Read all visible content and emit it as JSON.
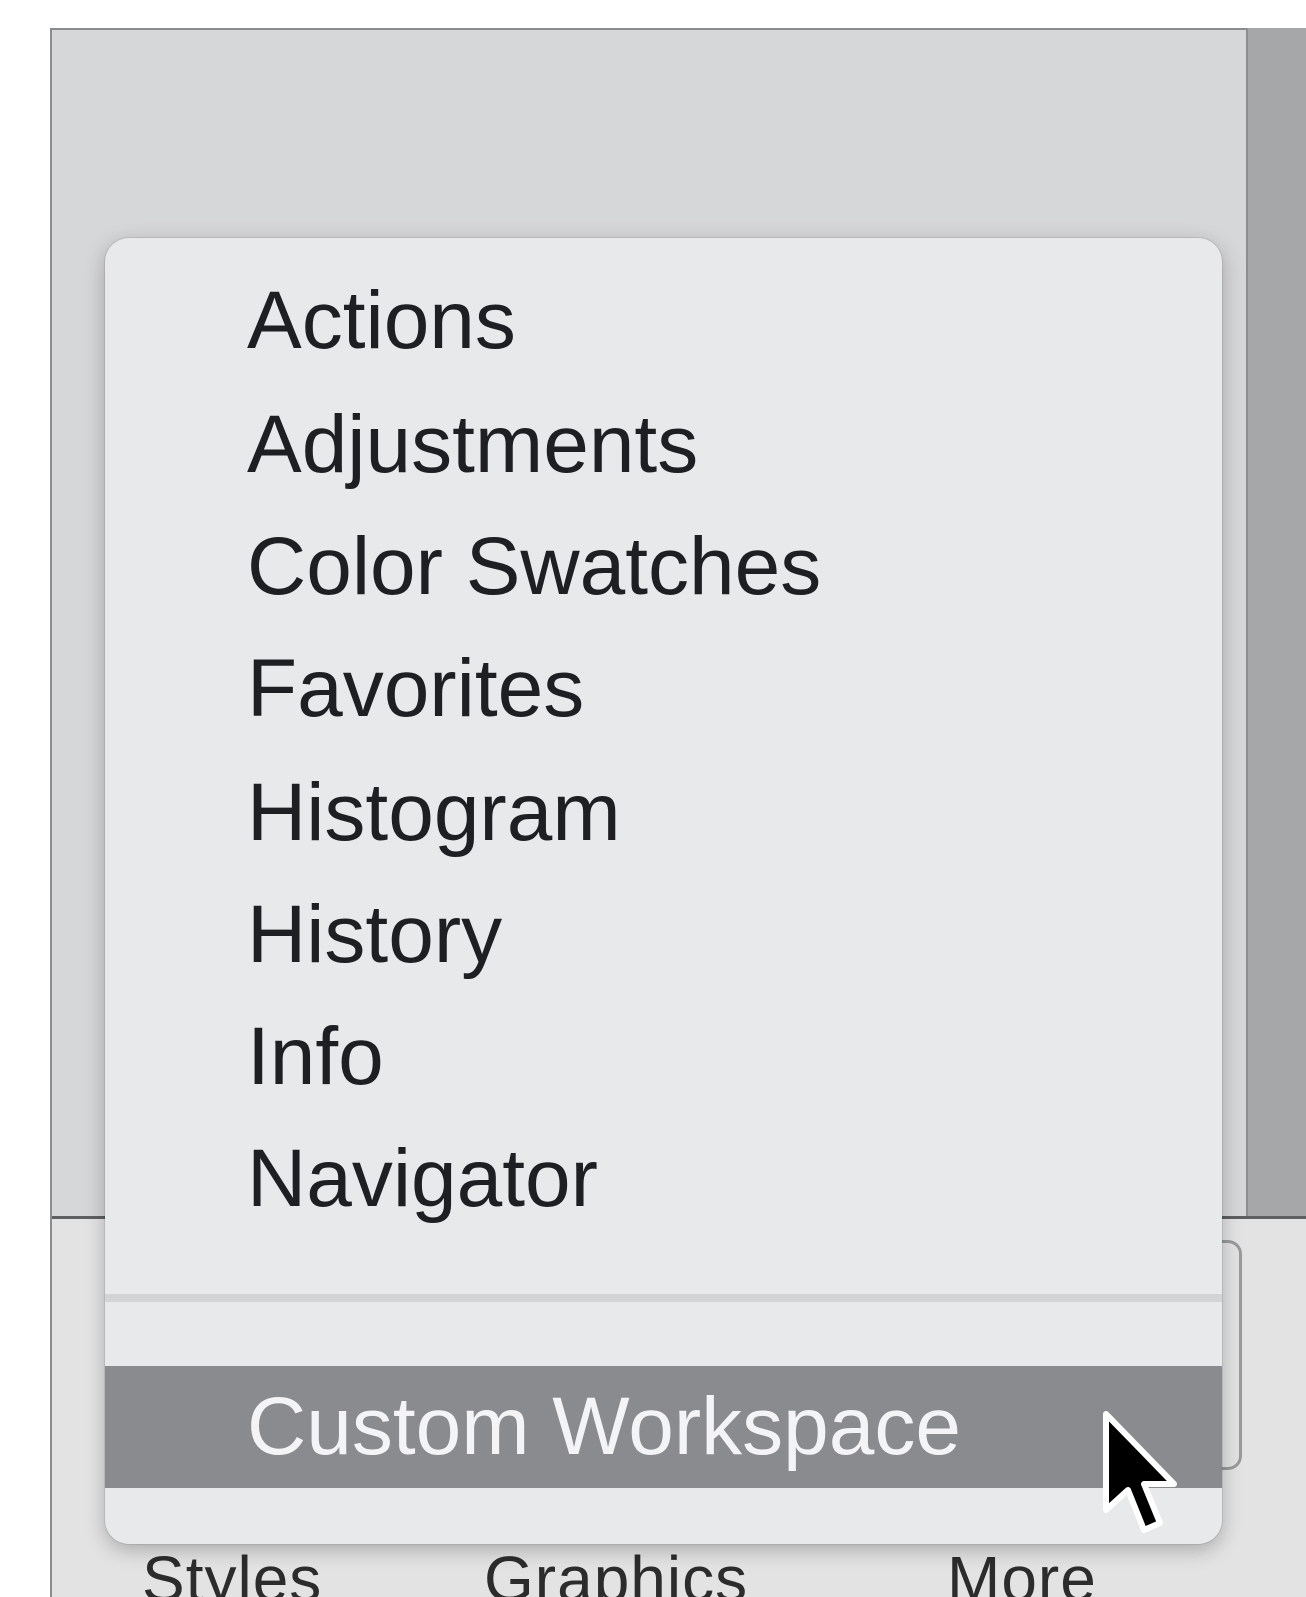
{
  "bottom_tabs": [
    {
      "label": "Styles"
    },
    {
      "label": "Graphics"
    },
    {
      "label": "More"
    }
  ],
  "menu": {
    "items": [
      {
        "label": "Actions"
      },
      {
        "label": "Adjustments"
      },
      {
        "label": "Color Swatches"
      },
      {
        "label": "Favorites"
      },
      {
        "label": "Histogram"
      },
      {
        "label": "History"
      },
      {
        "label": "Info"
      },
      {
        "label": "Navigator"
      }
    ],
    "footer_item": {
      "label": "Custom Workspace"
    }
  },
  "colors": {
    "panel_background": "#d6d7d8",
    "menu_background": "#e8e9ea",
    "highlight": "#8a8b8f",
    "highlight_text": "#f4f4f6"
  },
  "icons": {
    "cursor": "arrow-pointer-icon"
  }
}
